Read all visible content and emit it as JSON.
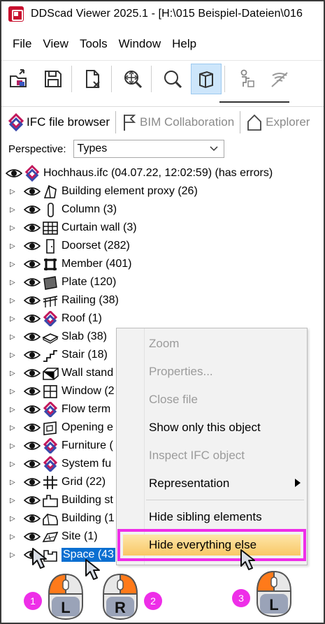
{
  "window": {
    "title": "DDScad Viewer 2025.1 - [H:\\015 Beispiel-Dateien\\016"
  },
  "menu": [
    "File",
    "View",
    "Tools",
    "Window",
    "Help"
  ],
  "toolbar": {
    "buttons": [
      "open-model-icon",
      "save-icon",
      "close-file-icon",
      "zoom-extents-icon",
      "zoom-icon",
      "view-cube-icon",
      "walk-icon",
      "wifi-icon"
    ],
    "active": "view-cube-icon"
  },
  "tabs": [
    {
      "label": "IFC file browser",
      "icon": "ifc-logo-icon"
    },
    {
      "label": "BIM Collaboration",
      "icon": "flag-icon"
    },
    {
      "label": "Explorer",
      "icon": "house-icon"
    }
  ],
  "perspective": {
    "label": "Perspective:",
    "value": "Types"
  },
  "tree": {
    "root": "Hochhaus.ifc (04.07.22, 12:02:59) (has errors)",
    "items": [
      {
        "label": "Building element proxy (26)",
        "icon": "proxy-icon"
      },
      {
        "label": "Column (3)",
        "icon": "column-icon"
      },
      {
        "label": "Curtain wall (3)",
        "icon": "curtain-wall-icon"
      },
      {
        "label": "Doorset (282)",
        "icon": "door-icon"
      },
      {
        "label": "Member (401)",
        "icon": "member-icon"
      },
      {
        "label": "Plate (120)",
        "icon": "plate-icon"
      },
      {
        "label": "Railing (38)",
        "icon": "railing-icon"
      },
      {
        "label": "Roof (1)",
        "icon": "ifc-logo-icon"
      },
      {
        "label": "Slab (38)",
        "icon": "slab-icon"
      },
      {
        "label": "Stair (18)",
        "icon": "stair-icon"
      },
      {
        "label": "Wall stand",
        "icon": "wall-icon"
      },
      {
        "label": "Window (2",
        "icon": "window-icon"
      },
      {
        "label": "Flow term",
        "icon": "ifc-logo-icon"
      },
      {
        "label": "Opening e",
        "icon": "opening-icon"
      },
      {
        "label": "Furniture (",
        "icon": "ifc-logo-icon"
      },
      {
        "label": "System fu",
        "icon": "ifc-logo-icon"
      },
      {
        "label": "Grid (22)",
        "icon": "grid-icon"
      },
      {
        "label": "Building st",
        "icon": "building-storey-icon"
      },
      {
        "label": "Building (1",
        "icon": "building-icon"
      },
      {
        "label": "Site (1)",
        "icon": "site-icon"
      },
      {
        "label": "Space (43",
        "icon": "space-icon",
        "selected": true
      }
    ]
  },
  "context_menu": {
    "items": [
      {
        "label": "Zoom",
        "enabled": false
      },
      {
        "label": "Properties...",
        "enabled": false
      },
      {
        "label": "Close file",
        "enabled": false
      },
      {
        "label": "Show only this object",
        "enabled": true
      },
      {
        "label": "Inspect IFC object",
        "enabled": false
      },
      {
        "label": "Representation",
        "enabled": true,
        "submenu": true
      },
      {
        "label": "Hide sibling elements",
        "enabled": true
      },
      {
        "label": "Hide everything else",
        "enabled": true,
        "highlighted": true
      }
    ]
  },
  "annotations": {
    "steps": [
      {
        "number": "1",
        "button": "L"
      },
      {
        "number": "2",
        "button": "R"
      },
      {
        "number": "3",
        "button": "L"
      }
    ],
    "accent_color": "#ee2ee8"
  }
}
